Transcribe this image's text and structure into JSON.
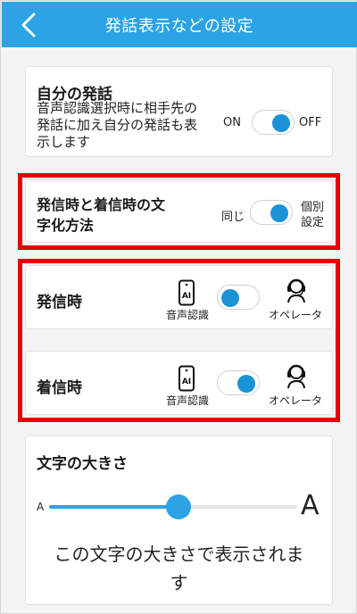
{
  "header": {
    "title": "発話表示などの設定",
    "background": "#2ba3e4"
  },
  "own_speech": {
    "title": "自分の発話",
    "description_lines": [
      "音声認識選択時に相手先の",
      "発話に加え自分の発話も表",
      "示します"
    ],
    "on_label": "ON",
    "off_label": "OFF",
    "state": "ON"
  },
  "method": {
    "title_lines": [
      "発信時と着信時の文",
      "字化方法"
    ],
    "left_label": "同じ",
    "right_label_lines": [
      "個別",
      "設定"
    ],
    "state": "個別設定"
  },
  "outgoing": {
    "title": "発信時",
    "left_label": "音声認識",
    "right_label": "オペレータ",
    "state": "音声認識"
  },
  "incoming": {
    "title": "着信時",
    "left_label": "音声認識",
    "right_label": "オペレータ",
    "state": "オペレータ"
  },
  "text_size": {
    "title": "文字の大きさ",
    "small_label": "A",
    "large_label": "A",
    "level": 0.52,
    "preview_lines": [
      "この文字の大きさで表示されま",
      "す"
    ]
  },
  "colors": {
    "accent": "#2ba3e4",
    "highlight": "#e60000"
  },
  "icons": {
    "back": "chevron-left-icon",
    "ai_phone": "ai-phone-icon",
    "operator": "operator-headset-icon"
  }
}
